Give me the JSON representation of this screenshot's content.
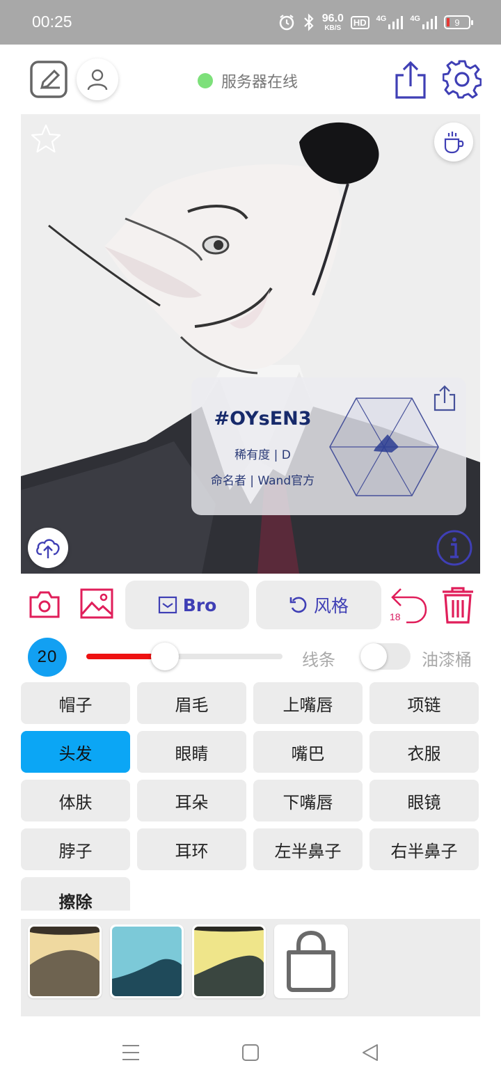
{
  "status_bar": {
    "time": "00:25",
    "network_speed": "96.0",
    "network_speed_unit": "KB/S",
    "hd_label": "HD",
    "signal_1": "4G",
    "signal_2": "4G",
    "battery_level": "9",
    "battery_color": "#e53935"
  },
  "app_bar": {
    "server_status": "服务器在线",
    "server_status_color": "#7de07a",
    "accent_color": "#3f3fb5"
  },
  "canvas": {
    "card": {
      "code": "#OYsEN3",
      "rarity": "稀有度 | D",
      "namer": "命名者 | Wand官方"
    }
  },
  "toolbar": {
    "bro_label": "Bro",
    "style_label": "风格",
    "undo_count": "18",
    "icon_color": "#e01e5a"
  },
  "brush": {
    "size": "20",
    "slider_level_percent": 40,
    "lines_label": "线条",
    "paint_bucket_label": "油漆桶",
    "paint_bucket_on": false
  },
  "parts": [
    {
      "label": "帽子",
      "active": false
    },
    {
      "label": "眉毛",
      "active": false
    },
    {
      "label": "上嘴唇",
      "active": false
    },
    {
      "label": "项链",
      "active": false
    },
    {
      "label": "头发",
      "active": true
    },
    {
      "label": "眼睛",
      "active": false
    },
    {
      "label": "嘴巴",
      "active": false
    },
    {
      "label": "衣服",
      "active": false
    },
    {
      "label": "体肤",
      "active": false
    },
    {
      "label": "耳朵",
      "active": false
    },
    {
      "label": "下嘴唇",
      "active": false
    },
    {
      "label": "眼镜",
      "active": false
    },
    {
      "label": "脖子",
      "active": false
    },
    {
      "label": "耳环",
      "active": false
    },
    {
      "label": "左半鼻子",
      "active": false
    },
    {
      "label": "右半鼻子",
      "active": false
    },
    {
      "label": "擦除",
      "active": false
    }
  ],
  "style_presets": [
    {
      "name": "style-preset",
      "bg": "#efd9a0",
      "fg": "#6e6350"
    },
    {
      "name": "style-preset",
      "bg": "#7cc9d8",
      "fg": "#1f4a5a"
    },
    {
      "name": "style-preset",
      "bg": "#efe58a",
      "fg": "#3a4640"
    }
  ],
  "active_color": "#0ba6f5"
}
